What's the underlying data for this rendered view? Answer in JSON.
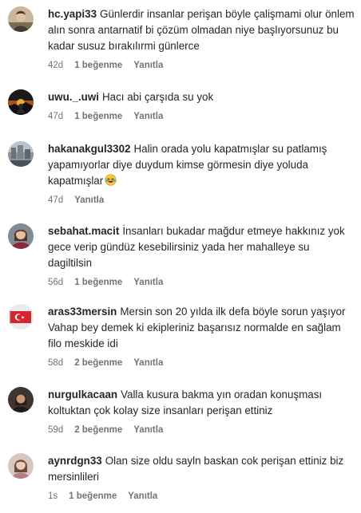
{
  "comments": [
    {
      "username": "hc.yapi33",
      "text": "Günlerdir insanlar perişan böyle çalişmami olur önlem alın sonra antarnatif bi çözüm olmadan niye başlıyorsunuz bu kadar susuz bırakılırmi günlerce",
      "age": "42d",
      "likes": "1 beğenme",
      "reply": "Yanıtla",
      "avatar_icon": "avatar-photo-person"
    },
    {
      "username": "uwu._.uwi",
      "text": "Hacı abi çarşıda su yok",
      "age": "47d",
      "likes": "1 beğenme",
      "reply": "Yanıtla",
      "avatar_icon": "avatar-photo-sunset"
    },
    {
      "username": "hakanakgul3302",
      "text": "Halin orada yolu kapatmışlar su patlamış yapamıyorlar diye duydum kimse görmesin diye yoluda kapatmışlar",
      "emoji": "laughing-tears-emoji",
      "age": "47d",
      "likes": "",
      "reply": "Yanıtla",
      "avatar_icon": "avatar-photo-city"
    },
    {
      "username": "sebahat.macit",
      "text": "İnsanları bukadar mağdur etmeye hakkınız yok gece verip gündüz kesebilirsiniz yada her mahalleye su dagiltilsin",
      "age": "56d",
      "likes": "1 beğenme",
      "reply": "Yanıtla",
      "avatar_icon": "avatar-photo-woman"
    },
    {
      "username": "aras33mersin",
      "text": "Mersin son 20 yılda ilk defa böyle sorun yaşıyor Vahap bey demek ki ekipleriniz başarısız normalde en sağlam filo meskide idi",
      "age": "58d",
      "likes": "2 beğenme",
      "reply": "Yanıtla",
      "avatar_icon": "avatar-photo-flag"
    },
    {
      "username": "nurgulkacaan",
      "text": "Valla kusura bakma yın oradan konuşması koltuktan çok kolay size insanları perişan ettiniz",
      "age": "59d",
      "likes": "2 beğenme",
      "reply": "Yanıtla",
      "avatar_icon": "avatar-photo-person-dark"
    },
    {
      "username": "aynrdgn33",
      "text": "Olan size oldu sayln baskan cok perişan ettiniz biz mersinlileri",
      "age": "1s",
      "likes": "1 beğenme",
      "reply": "Yanıtla",
      "avatar_icon": "avatar-photo-woman-light"
    }
  ]
}
